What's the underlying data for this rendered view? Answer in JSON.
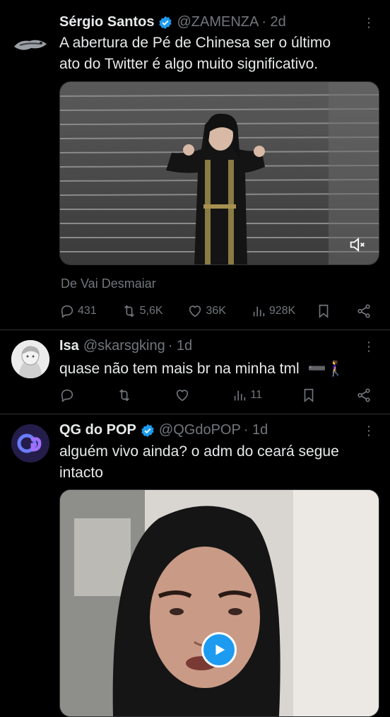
{
  "tweets": [
    {
      "name": "Sérgio Santos",
      "handle": "@ZAMENZA",
      "time": "· 2d",
      "verified": true,
      "text_lines": [
        "A abertura de Pé de Chinesa ser o último",
        "ato do Twitter é algo muito significativo."
      ],
      "source": "De Vai Desmaiar",
      "media": {
        "type": "video",
        "muted_icon": "speaker-muted-icon"
      },
      "actions": {
        "replies": "431",
        "reposts": "5,6K",
        "likes": "36K",
        "views": "928K"
      }
    },
    {
      "name": "Isa",
      "handle": "@skarsgking",
      "time": "· 1d",
      "verified": false,
      "text": "quase não tem mais br na minha tml",
      "emoji": "➖🚶‍♀️",
      "actions": {
        "replies": "",
        "reposts": "",
        "likes": "",
        "views": "11"
      }
    },
    {
      "name": "QG do POP",
      "handle": "@QGdoPOP",
      "time": "· 1d",
      "verified": true,
      "text_lines": [
        "alguém vivo ainda? o adm do ceará segue",
        "intacto"
      ],
      "media": {
        "type": "video",
        "play_icon": "play-icon"
      }
    }
  ],
  "colors": {
    "background": "#000000",
    "text": "#e7e9ea",
    "muted": "#71767b",
    "verified": "#1d9bf0",
    "divider": "#2f3336"
  }
}
